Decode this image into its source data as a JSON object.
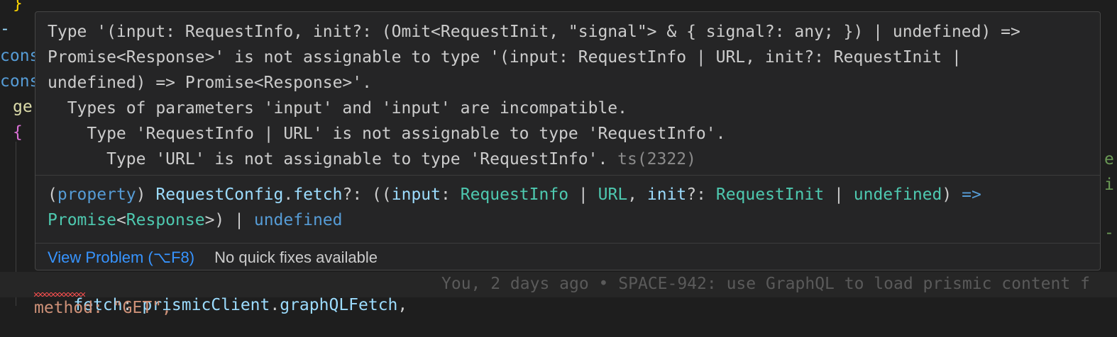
{
  "editor": {
    "bg_line1": "}",
    "bg_line3": "cons",
    "bg_line4": "cons",
    "bg_line5": "ge",
    "bg_line6": "{",
    "code_line": {
      "prop": "fetch",
      "colon": ":",
      "obj": "prismicClient",
      "dot": ".",
      "method": "graphQLFetch",
      "comma": ","
    },
    "blame": "You, 2 days ago • SPACE-942: use GraphQL to load prismic content f",
    "partial_next": "method: \"GET\","
  },
  "hover": {
    "diagnostic_lines": [
      "Type '(input: RequestInfo, init?: (Omit<RequestInit, \"signal\"> & { signal?: any; }) | undefined) =>",
      "Promise<Response>' is not assignable to type '(input: RequestInfo | URL, init?: RequestInit |",
      "undefined) => Promise<Response>'.",
      "  Types of parameters 'input' and 'input' are incompatible.",
      "    Type 'RequestInfo | URL' is not assignable to type 'RequestInfo'.",
      "      Type 'URL' is not assignable to type 'RequestInfo'. "
    ],
    "error_code": "ts(2322)",
    "signature": {
      "open_paren": "(",
      "kind": "property",
      "close_paren": ")",
      "owner": "RequestConfig",
      "dot": ".",
      "name": "fetch",
      "optional_colon": "?:",
      "paren_open2": "((",
      "param1": "input",
      "colon1": ":",
      "type1": "RequestInfo",
      "pipe1": "|",
      "type2": "URL",
      "comma1": ",",
      "param2": "init",
      "opt2": "?:",
      "type3": "RequestInit",
      "pipe2": "|",
      "type4": "undefined",
      "close_paren2": ")",
      "arrow": "=>",
      "ret_type": "Promise",
      "lt": "<",
      "ret_arg": "Response",
      "gt_paren": ">)",
      "pipe3": "|",
      "type5": "undefined"
    },
    "actions": {
      "view_problem": "View Problem (⌥F8)",
      "no_quick_fixes": "No quick fixes available"
    }
  },
  "colors": {
    "background": "#1e1e1e",
    "tooltip_bg": "#252526",
    "link": "#3794ff",
    "error": "#f14c4c",
    "type": "#4ec9b0",
    "keyword": "#569cd6",
    "property": "#9cdcfe"
  }
}
